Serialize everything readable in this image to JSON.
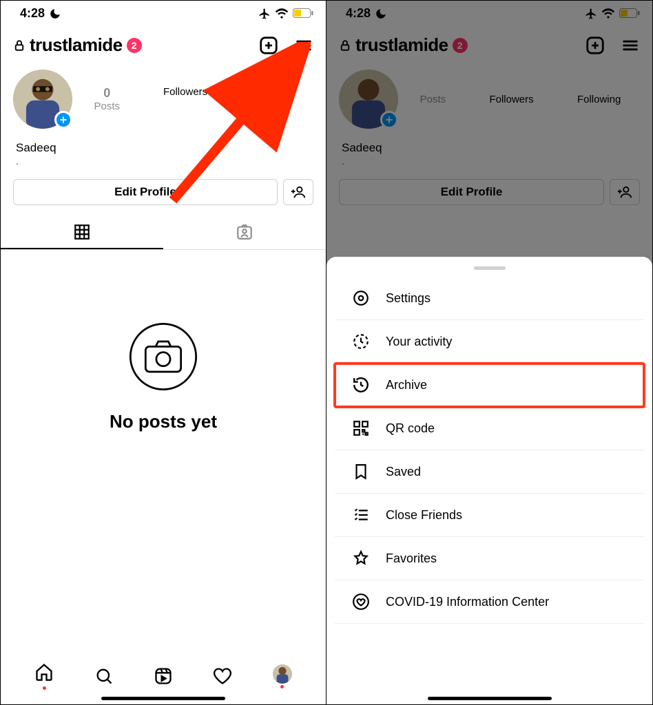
{
  "status": {
    "time": "4:28"
  },
  "profile": {
    "username": "trustlamide",
    "badge_count": "2",
    "display_name": "Sadeeq",
    "subtext": ".",
    "stats": {
      "posts_number": "0",
      "posts_label": "Posts",
      "followers_label": "Followers",
      "following_label": "Following"
    },
    "edit_button": "Edit Profile",
    "empty_state": "No posts yet"
  },
  "menu": {
    "items": [
      {
        "label": "Settings"
      },
      {
        "label": "Your activity"
      },
      {
        "label": "Archive"
      },
      {
        "label": "QR code"
      },
      {
        "label": "Saved"
      },
      {
        "label": "Close Friends"
      },
      {
        "label": "Favorites"
      },
      {
        "label": "COVID-19 Information Center"
      }
    ],
    "highlighted_index": 2
  },
  "colors": {
    "accent_blue": "#0095f6",
    "badge_pink": "#ff3366",
    "highlight_red": "#ff3b1f",
    "battery_yellow": "#ffcc00"
  }
}
